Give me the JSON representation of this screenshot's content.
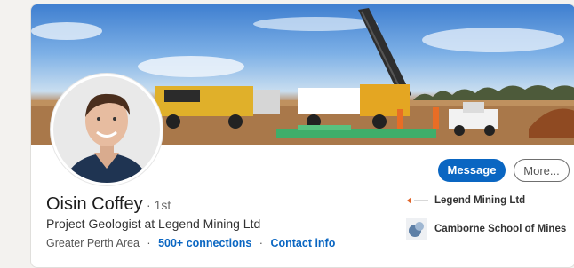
{
  "profile": {
    "name": "Oisin Coffey",
    "degree": "· 1st",
    "headline": "Project Geologist at Legend Mining Ltd",
    "location": "Greater Perth Area",
    "separator": "·",
    "connections": "500+ connections",
    "contact_info": "Contact info"
  },
  "actions": {
    "message_label": "Message",
    "more_label": "More..."
  },
  "experience": {
    "company": "Legend Mining Ltd",
    "company_logo_icon": "legend-mining-logo-icon",
    "school": "Camborne School of Mines",
    "school_logo_icon": "camborne-school-logo-icon"
  },
  "images": {
    "cover": "drill-rig-cover-photo",
    "avatar": "profile-photo"
  },
  "colors": {
    "accent": "#0a66c2",
    "page_background": "#f3f2ef",
    "card_background": "#ffffff"
  }
}
